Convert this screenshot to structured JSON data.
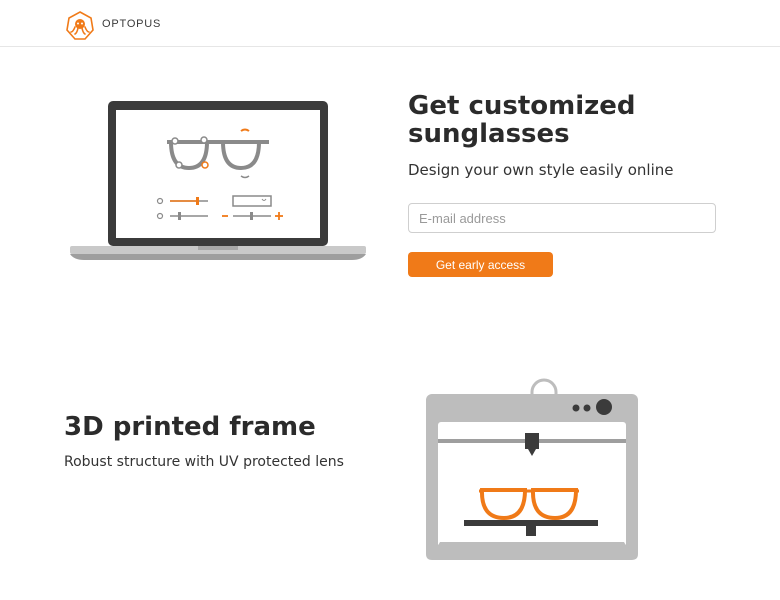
{
  "header": {
    "brand": "OPTOPUS",
    "logo_icon": "octopus-icon"
  },
  "hero": {
    "title": "Get customized sunglasses",
    "subtitle": "Design your own style easily online",
    "email_placeholder": "E-mail address",
    "email_value": "",
    "cta_label": "Get early access",
    "illustration_icon": "laptop-glasses-editor-icon"
  },
  "feature": {
    "title": "3D printed frame",
    "subtitle": "Robust structure with UV protected lens",
    "illustration_icon": "3d-printer-icon"
  },
  "colors": {
    "accent": "#f07a18",
    "text": "#2b2b2b",
    "gray": "#bdbdbd"
  }
}
